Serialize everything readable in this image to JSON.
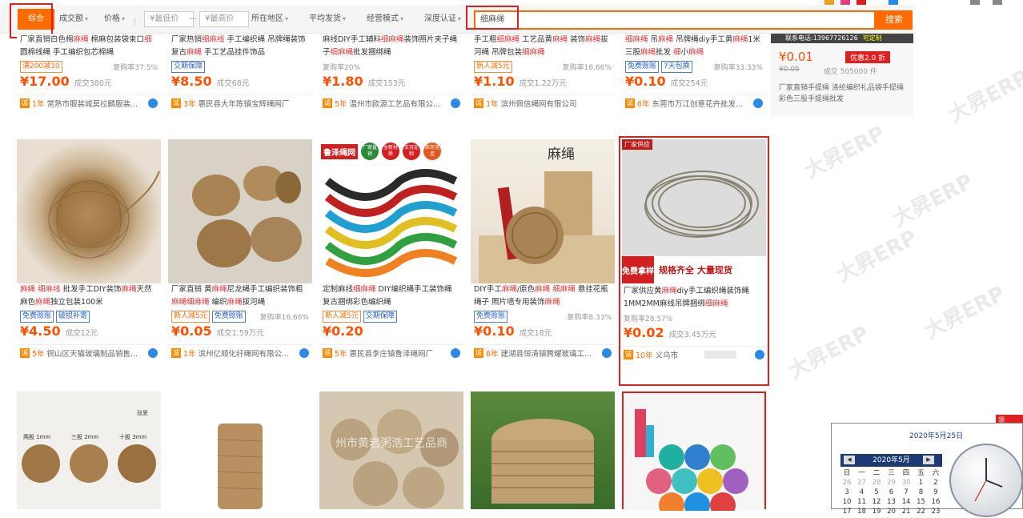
{
  "filter": {
    "sort_default": "综合",
    "sort_sales": "成交额",
    "sort_price": "价格",
    "price_min_placeholder": "¥最低价",
    "price_dash": "—",
    "price_max_placeholder": "¥最高价",
    "location": "所在地区",
    "delivery": "平均发货",
    "business_mode": "经营模式",
    "certification": "深度认证",
    "search_value": "细麻绳",
    "search_button": "搜索"
  },
  "ad": {
    "tel": "联系电话:13967726126",
    "custom": "可定制",
    "price": "¥0.01",
    "old_price": "¥0.05",
    "promo": "优惠2.0 折",
    "deal": "成交 505000 件",
    "desc": "厂家直销手提绳 涤纶编织礼品袋手提绳 彩色三股手提绳批发"
  },
  "row1": [
    {
      "title": "厂家直销白色棉麻绳 棉麻包装袋束口细圆棉线绳 手工编织包芯棉绳",
      "tags": [
        "满200减10"
      ],
      "rate": "复购率37.5%",
      "price": "17.00",
      "deal": "成交380元",
      "years": "1年",
      "shop": "常熟市服装城莫拉麟服装..."
    },
    {
      "title": "厂家热销细麻线 手工编织绳 吊牌绳装饰复古麻绳 手工艺品挂件饰品",
      "tags": [
        "交期保障"
      ],
      "rate": "",
      "price": "8.50",
      "deal": "成交68元",
      "years": "3年",
      "shop": "惠民县大年陈镇宝辉绳网厂"
    },
    {
      "title": "麻线DIY手工辅料细麻绳装饰照片夹子绳子细麻绳批发捆绑绳",
      "tags": [],
      "rate": "复购率20%",
      "price": "1.80",
      "deal": "成交153元",
      "years": "5年",
      "shop": "温州市欧源工艺品有限公..."
    },
    {
      "title": "手工粗细麻绳 工艺品黄麻绳 装饰麻绳拔河绳 吊牌包装细麻绳",
      "tags": [
        "新人减5元"
      ],
      "rate": "复购率16.66%",
      "price": "1.10",
      "deal": "成交1.22万元",
      "years": "1年",
      "shop": "滨州佩信绳网有限公司"
    },
    {
      "title": "细麻绳 吊麻绳 吊牌绳diy手工黄麻绳1米 三股麻绳批发 细小麻绳",
      "tags": [
        "免费赊账",
        "7天包换"
      ],
      "rate": "复购率33.33%",
      "price": "0.10",
      "deal": "成交254元",
      "years": "6年",
      "shop": "东莞市万江创意花卉批发..."
    }
  ],
  "row2": [
    {
      "title": "麻绳 细麻线 批发手工DIY装饰麻绳天然麻色麻绳独立包装100米",
      "tags": [
        "免费赊账",
        "破损补寄"
      ],
      "rate": "",
      "price": "4.50",
      "deal": "成交12元",
      "years": "5年",
      "shop": "铜山区天猫玻璃制品销售..."
    },
    {
      "title": "厂家直销 黄麻绳尼龙绳手工编织装饰粗麻绳细麻绳 编织麻绳拔河绳",
      "tags": [
        "新人减5元",
        "免费赊账"
      ],
      "rate": "复购率16.66%",
      "price": "0.05",
      "deal": "成交1.59万元",
      "years": "1年",
      "shop": "滨州亿顺化纤绳网有限公..."
    },
    {
      "title": "定制麻线细麻绳 DIY编织绳手工装饰绳 复古捆绑彩色编织绳",
      "tags": [
        "新人减5元",
        "交期保障"
      ],
      "rate": "",
      "price": "0.20",
      "deal": "",
      "years": "5年",
      "shop": "惠民县李庄镇鲁泽绳网厂"
    },
    {
      "title": "DIY手工麻绳/原色麻绳 细麻绳 悬挂花瓶绳子 照片墙专用装饰麻绳",
      "tags": [
        "免费赊账"
      ],
      "rate": "复购率8.33%",
      "price": "0.10",
      "deal": "成交18元",
      "years": "6年",
      "shop": "建湖县恒清镇腾耀玻璃工..."
    },
    {
      "title": "厂家供应黄麻绳diy手工编织绳装饰绳1MM2MM麻线吊牌捆绑细麻绳",
      "tags": [],
      "rate": "复购率28.57%",
      "price": "0.02",
      "deal": "成交3.45万元",
      "years": "10年",
      "shop": "义乌市"
    }
  ],
  "img_text": {
    "lr_brand": "鲁泽绳网",
    "lr_f1": "厂家直销",
    "lr_f2": "全新材质",
    "lr_f3": "支持定制",
    "lr_f4": "库存充足",
    "mashen": "麻绳",
    "factory": "厂家供应",
    "free": "免费拿样",
    "spec": "规格齐全 大量现货",
    "d1": "两股 1mm",
    "d2": "三股 2mm",
    "d3": "十股 3mm",
    "watermark_shop": "州市黄岩粥浩工艺品商",
    "brand_small": "鼓夏"
  },
  "calendar": {
    "date_text": "2020年5月25日",
    "month": "2020年5月",
    "weekdays": [
      "日",
      "一",
      "二",
      "三",
      "四",
      "五",
      "六"
    ],
    "row1": [
      "26",
      "27",
      "28",
      "29",
      "30",
      "1",
      "2"
    ],
    "row2": [
      "3",
      "4",
      "5",
      "6",
      "7",
      "8",
      "9"
    ],
    "row3": [
      "10",
      "11",
      "12",
      "13",
      "14",
      "15",
      "16"
    ],
    "row4": [
      "17",
      "18",
      "19",
      "20",
      "21",
      "22",
      "23"
    ],
    "corner": "领"
  },
  "watermark": "大昇ERP"
}
